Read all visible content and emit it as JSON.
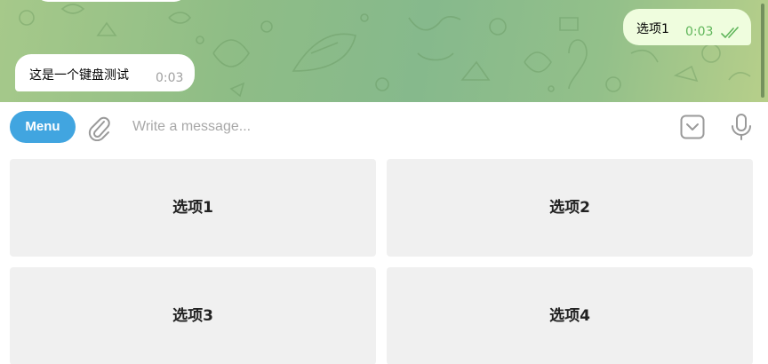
{
  "chat": {
    "messages": [
      {
        "direction": "outgoing",
        "text": "选项1",
        "time": "0:03",
        "status": "read"
      },
      {
        "direction": "incoming",
        "text": "这是一个键盘测试",
        "time": "0:03"
      }
    ]
  },
  "compose": {
    "menu_label": "Menu",
    "placeholder": "Write a message...",
    "value": "",
    "attach_icon": "paperclip-icon",
    "keyboard_toggle_icon": "chevron-down-square-icon",
    "mic_icon": "microphone-icon"
  },
  "keyboard": {
    "buttons": [
      {
        "label": "选项1"
      },
      {
        "label": "选项2"
      },
      {
        "label": "选项3"
      },
      {
        "label": "选项4"
      }
    ]
  },
  "colors": {
    "accent": "#41a5e0",
    "outgoing_bubble": "#effdde",
    "outgoing_time": "#5fb55a",
    "incoming_bubble": "#ffffff",
    "keyboard_button": "#f0f0f0"
  }
}
